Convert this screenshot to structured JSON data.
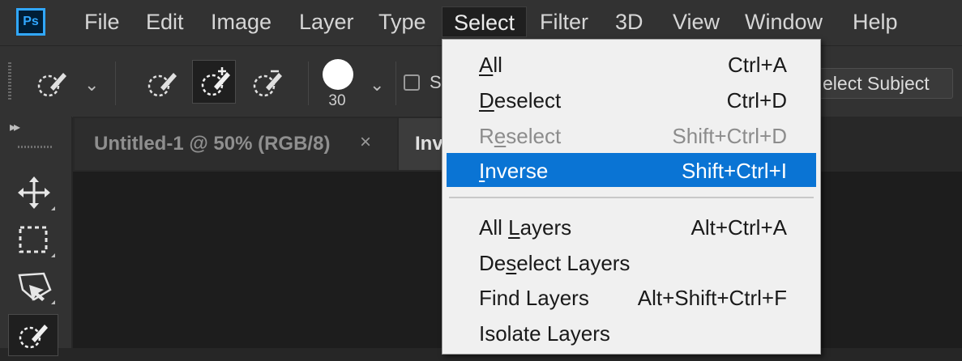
{
  "app": {
    "logo_text": "Ps",
    "accent_color": "#31a8ff"
  },
  "menubar": {
    "items": [
      "File",
      "Edit",
      "Image",
      "Layer",
      "Type",
      "Select",
      "Filter",
      "3D",
      "View",
      "Window",
      "Help"
    ],
    "active": "Select"
  },
  "options": {
    "brush_size": "30",
    "sample_label": "S",
    "select_subject_label": "elect Subject"
  },
  "tabs": [
    {
      "label": "Untitled-1 @ 50% (RGB/8)",
      "close": "×"
    },
    {
      "label": "Inv"
    }
  ],
  "select_menu": {
    "items": [
      {
        "pre": "",
        "ul": "A",
        "post": "ll",
        "shortcut": "Ctrl+A",
        "state": "normal"
      },
      {
        "pre": "",
        "ul": "D",
        "post": "eselect",
        "shortcut": "Ctrl+D",
        "state": "normal"
      },
      {
        "pre": "R",
        "ul": "e",
        "post": "select",
        "shortcut": "Shift+Ctrl+D",
        "state": "disabled"
      },
      {
        "pre": "",
        "ul": "I",
        "post": "nverse",
        "shortcut": "Shift+Ctrl+I",
        "state": "highlighted"
      },
      {
        "pre": "All ",
        "ul": "L",
        "post": "ayers",
        "shortcut": "Alt+Ctrl+A",
        "state": "normal"
      },
      {
        "pre": "De",
        "ul": "s",
        "post": "elect Layers",
        "shortcut": "",
        "state": "normal"
      },
      {
        "pre": "Find Layers",
        "ul": "",
        "post": "",
        "shortcut": "Alt+Shift+Ctrl+F",
        "state": "normal"
      },
      {
        "pre": "Isolate Layers",
        "ul": "",
        "post": "",
        "shortcut": "",
        "state": "normal"
      }
    ],
    "highlight_color": "#0a74d4"
  },
  "icons": {
    "options_bar": [
      "quick-selection-tool-icon",
      "new-selection-icon",
      "add-to-selection-icon",
      "subtract-from-selection-icon",
      "brush-preview-icon"
    ],
    "toolbar": [
      "move-tool-icon",
      "rectangular-marquee-icon",
      "object-selection-icon",
      "quick-selection-tool-icon"
    ]
  }
}
